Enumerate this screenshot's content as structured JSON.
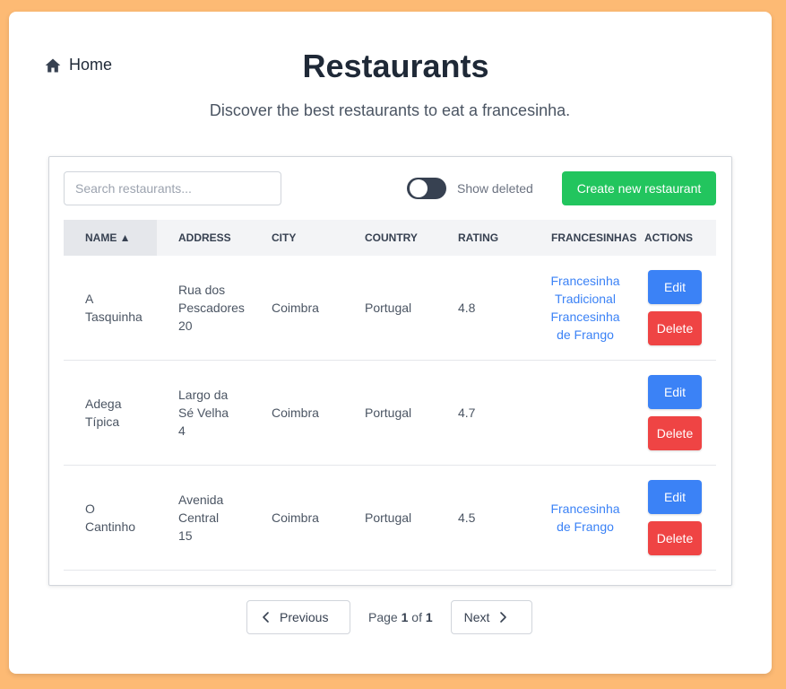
{
  "nav": {
    "home_label": "Home",
    "home_icon": "home-icon"
  },
  "header": {
    "title": "Restaurants",
    "subtitle": "Discover the best restaurants to eat a francesinha."
  },
  "toolbar": {
    "search_placeholder": "Search restaurants...",
    "search_value": "",
    "show_deleted_label": "Show deleted",
    "show_deleted_on": false,
    "create_label": "Create new restaurant"
  },
  "table": {
    "columns": [
      "NAME ▲",
      "ADDRESS",
      "CITY",
      "COUNTRY",
      "RATING",
      "FRANCESINHAS",
      "ACTIONS"
    ],
    "rows": [
      {
        "name": "A\nTasquinha",
        "address": "Rua dos\nPescadores\n20",
        "city": "Coimbra",
        "country": "Portugal",
        "rating": "4.8",
        "francesinhas": [
          "Francesinha\nTradicional",
          "Francesinha\nde Frango"
        ],
        "edit_label": "Edit",
        "delete_label": "Delete"
      },
      {
        "name": "Adega\nTípica",
        "address": "Largo da\nSé Velha\n4",
        "city": "Coimbra",
        "country": "Portugal",
        "rating": "4.7",
        "francesinhas": [],
        "edit_label": "Edit",
        "delete_label": "Delete"
      },
      {
        "name": "O\nCantinho",
        "address": "Avenida\nCentral\n15",
        "city": "Coimbra",
        "country": "Portugal",
        "rating": "4.5",
        "francesinhas": [
          "Francesinha\nde Frango"
        ],
        "edit_label": "Edit",
        "delete_label": "Delete"
      }
    ]
  },
  "pagination": {
    "previous_label": "Previous",
    "next_label": "Next",
    "page_prefix": "Page",
    "current_page": "1",
    "of_label": "of",
    "total_pages": "1"
  },
  "colors": {
    "background": "#fdba74",
    "create_button": "#22c55e",
    "edit_button": "#3b82f6",
    "delete_button": "#ef4444",
    "link": "#3b82f6",
    "toggle_off": "#374151"
  }
}
